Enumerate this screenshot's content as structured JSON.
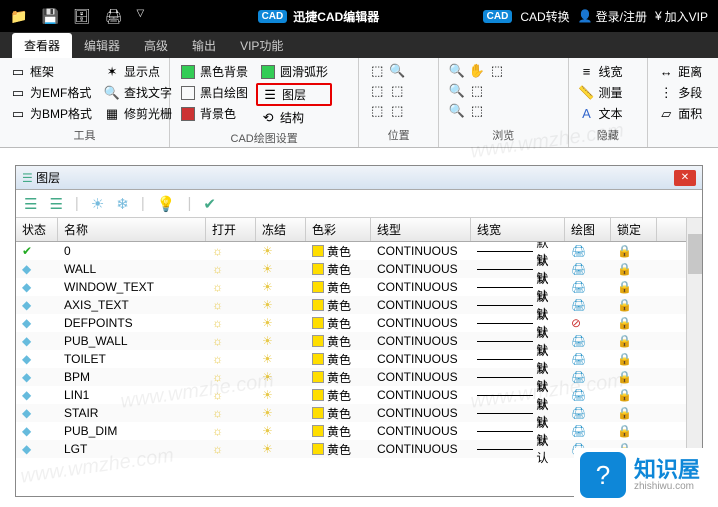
{
  "app": {
    "title": "迅捷CAD编辑器",
    "badge": "CAD"
  },
  "titlebar_right": {
    "convert": "CAD转换",
    "login": "登录/注册",
    "vip": "加入VIP"
  },
  "tabs": [
    "查看器",
    "编辑器",
    "高级",
    "输出",
    "VIP功能"
  ],
  "ribbon": {
    "g1": {
      "label": "工具",
      "items": [
        "框架",
        "为EMF格式",
        "为BMP格式",
        "显示点",
        "查找文字",
        "修剪光栅"
      ]
    },
    "g2": {
      "label": "CAD绘图设置",
      "items": [
        "黑色背景",
        "黑白绘图",
        "背景色",
        "圆滑弧形",
        "图层",
        "结构"
      ]
    },
    "g3": {
      "label": "位置"
    },
    "g4": {
      "label": "浏览"
    },
    "g5": {
      "label": "隐藏",
      "items": [
        "线宽",
        "测量",
        "文本"
      ]
    },
    "g6": {
      "items": [
        "距离",
        "多段",
        "面积"
      ]
    }
  },
  "panel": {
    "title": "图层"
  },
  "columns": {
    "status": "状态",
    "name": "名称",
    "open": "打开",
    "freeze": "冻结",
    "color": "色彩",
    "ltype": "线型",
    "lw": "线宽",
    "plot": "绘图",
    "lock": "锁定"
  },
  "color_label": "黄色",
  "ltype_val": "CONTINUOUS",
  "lw_val": "默认",
  "layers": [
    "0",
    "WALL",
    "WINDOW_TEXT",
    "AXIS_TEXT",
    "DEFPOINTS",
    "PUB_WALL",
    "TOILET",
    "BPM",
    "LIN1",
    "STAIR",
    "PUB_DIM",
    "LGT"
  ],
  "brand": {
    "name": "知识屋",
    "url": "zhishiwu.com"
  },
  "watermark": "www.wmzhe.com"
}
